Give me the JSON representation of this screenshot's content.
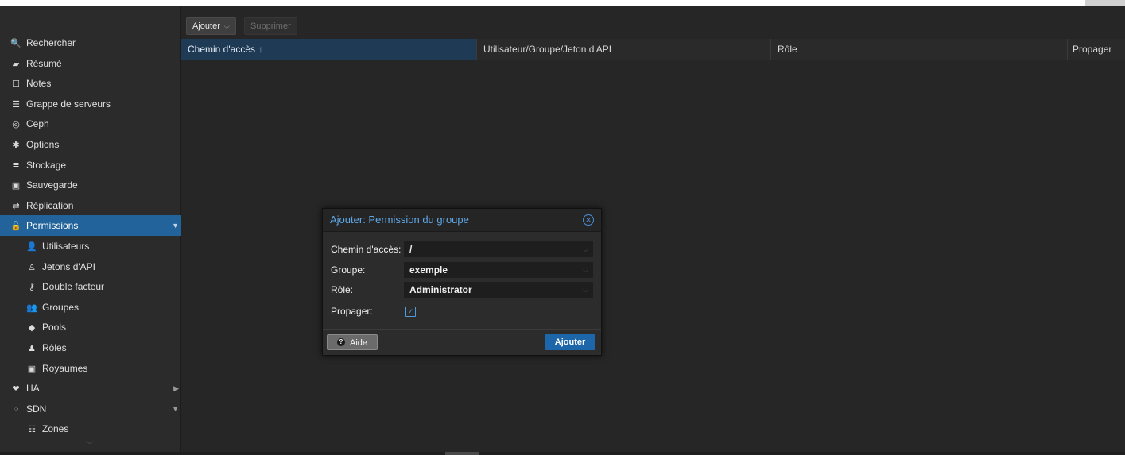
{
  "sidebar": {
    "items": [
      {
        "label": "Rechercher",
        "icon": "search-icon",
        "glyph": "🔍",
        "level": "top"
      },
      {
        "label": "Résumé",
        "icon": "summary-icon",
        "glyph": "▰",
        "level": "top"
      },
      {
        "label": "Notes",
        "icon": "notes-icon",
        "glyph": "☐",
        "level": "top"
      },
      {
        "label": "Grappe de serveurs",
        "icon": "server-cluster-icon",
        "glyph": "☰",
        "level": "top"
      },
      {
        "label": "Ceph",
        "icon": "ceph-icon",
        "glyph": "◎",
        "level": "top"
      },
      {
        "label": "Options",
        "icon": "gear-icon",
        "glyph": "✱",
        "level": "top"
      },
      {
        "label": "Stockage",
        "icon": "database-icon",
        "glyph": "≣",
        "level": "top"
      },
      {
        "label": "Sauvegarde",
        "icon": "floppy-icon",
        "glyph": "▣",
        "level": "top"
      },
      {
        "label": "Réplication",
        "icon": "replication-icon",
        "glyph": "⇄",
        "level": "top"
      },
      {
        "label": "Permissions",
        "icon": "unlock-icon",
        "glyph": "🔓",
        "level": "top",
        "active": true,
        "arrow": "▼"
      },
      {
        "label": "Utilisateurs",
        "icon": "user-icon",
        "glyph": "👤",
        "level": "sub"
      },
      {
        "label": "Jetons d'API",
        "icon": "api-token-icon",
        "glyph": "♙",
        "level": "sub"
      },
      {
        "label": "Double facteur",
        "icon": "key-icon",
        "glyph": "⚷",
        "level": "sub"
      },
      {
        "label": "Groupes",
        "icon": "users-icon",
        "glyph": "👥",
        "level": "sub"
      },
      {
        "label": "Pools",
        "icon": "tags-icon",
        "glyph": "◆",
        "level": "sub"
      },
      {
        "label": "Rôles",
        "icon": "male-icon",
        "glyph": "♟",
        "level": "sub"
      },
      {
        "label": "Royaumes",
        "icon": "realm-icon",
        "glyph": "▣",
        "level": "sub"
      },
      {
        "label": "HA",
        "icon": "heartbeat-icon",
        "glyph": "❤",
        "level": "top",
        "arrow": "▶"
      },
      {
        "label": "SDN",
        "icon": "sdn-icon",
        "glyph": "⁘",
        "level": "top",
        "arrow": "▼"
      },
      {
        "label": "Zones",
        "icon": "zones-icon",
        "glyph": "☷",
        "level": "sub"
      }
    ]
  },
  "toolbar": {
    "add_label": "Ajouter",
    "delete_label": "Supprimer"
  },
  "grid": {
    "columns": [
      "Chemin d'accès",
      "Utilisateur/Groupe/Jeton d'API",
      "Rôle",
      "Propager"
    ],
    "sort_indicator": "↑"
  },
  "dialog": {
    "title": "Ajouter: Permission du groupe",
    "fields": {
      "path": {
        "label": "Chemin d'accès:",
        "value": "/"
      },
      "group": {
        "label": "Groupe:",
        "value": "exemple"
      },
      "role": {
        "label": "Rôle:",
        "value": "Administrator"
      },
      "propagate": {
        "label": "Propager:",
        "checked": true
      }
    },
    "help_label": "Aide",
    "submit_label": "Ajouter"
  },
  "colors": {
    "accent": "#21639a",
    "title_blue": "#5fa8e8",
    "primary_button": "#1d66aa",
    "background": "#262626"
  }
}
